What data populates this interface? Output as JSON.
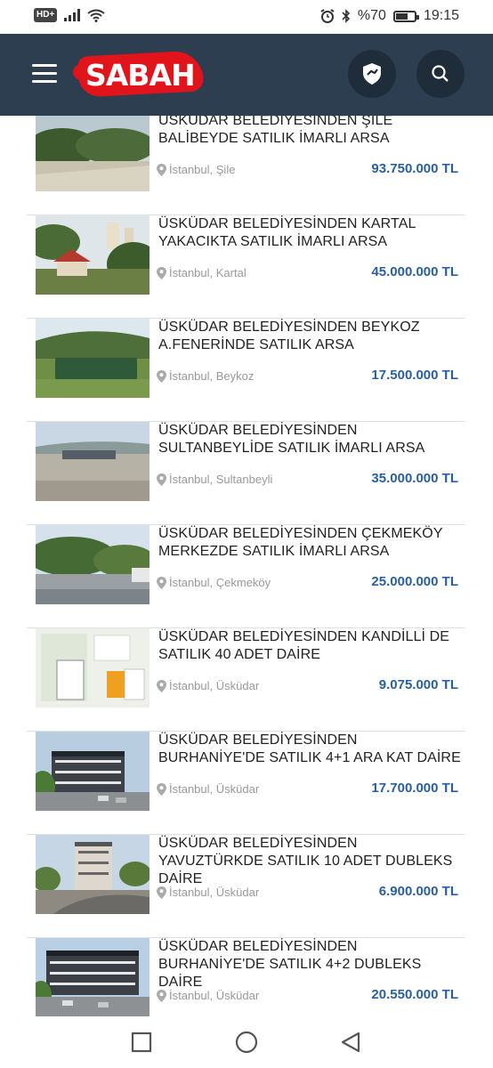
{
  "status_bar": {
    "network": "HD+",
    "battery_text": "%70",
    "battery_level": 0.7,
    "time": "19:15"
  },
  "header": {
    "logo_text": "SABAH",
    "brand_color": "#e1141b",
    "background": "#2c3e50"
  },
  "listings": [
    {
      "title": "ÜSKÜDAR BELEDİYESİNDEN ŞİLE BALİBEYDE SATILIK İMARLI ARSA",
      "location": "İstanbul, Şile",
      "price": "93.750.000 TL"
    },
    {
      "title": "ÜSKÜDAR BELEDİYESİNDEN KARTAL YAKACIKTA SATILIK İMARLI ARSA",
      "location": "İstanbul, Kartal",
      "price": "45.000.000 TL"
    },
    {
      "title": "ÜSKÜDAR BELEDİYESİNDEN BEYKOZ A.FENERİNDE SATILIK ARSA",
      "location": "İstanbul, Beykoz",
      "price": "17.500.000 TL"
    },
    {
      "title": "ÜSKÜDAR BELEDİYESİNDEN SULTANBEYLİDE SATILIK İMARLI ARSA",
      "location": "İstanbul, Sultanbeyli",
      "price": "35.000.000 TL"
    },
    {
      "title": "ÜSKÜDAR BELEDİYESİNDEN ÇEKMEKÖY MERKEZDE SATILIK İMARLI ARSA",
      "location": "İstanbul, Çekmeköy",
      "price": "25.000.000 TL"
    },
    {
      "title": "ÜSKÜDAR BELEDİYESİNDEN KANDİLLİ DE SATILIK 40 ADET DAİRE",
      "location": "İstanbul, Üsküdar",
      "price": "9.075.000 TL"
    },
    {
      "title": "ÜSKÜDAR BELEDİYESİNDEN BURHANİYE'DE SATILIK 4+1 ARA KAT DAİRE",
      "location": "İstanbul, Üsküdar",
      "price": "17.700.000 TL"
    },
    {
      "title": "ÜSKÜDAR BELEDİYESİNDEN YAVUZTÜRKDE SATILIK 10 ADET DUBLEKS DAİRE",
      "location": "İstanbul, Üsküdar",
      "price": "6.900.000 TL"
    },
    {
      "title": "ÜSKÜDAR BELEDİYESİNDEN BURHANİYE'DE SATILIK 4+2 DUBLEKS DAİRE",
      "location": "İstanbul, Üsküdar",
      "price": "20.550.000 TL"
    }
  ],
  "icons": {
    "menu": "hamburger-menu-icon",
    "shield": "shield-icon",
    "search": "search-icon",
    "location": "location-pin-icon"
  },
  "colors": {
    "price": "#2a5fa0"
  }
}
